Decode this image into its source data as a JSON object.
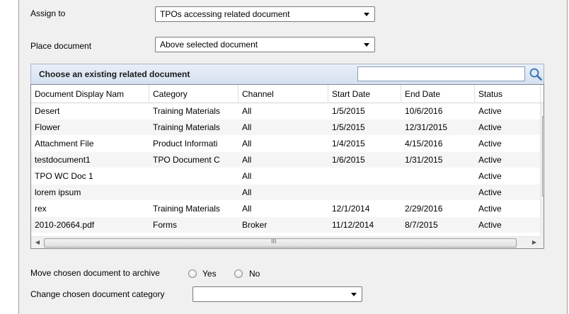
{
  "assign_to": {
    "label": "Assign to",
    "value": "TPOs accessing related document"
  },
  "place_document": {
    "label": "Place document",
    "value": "Above selected document"
  },
  "related_section": {
    "title": "Choose an existing related document",
    "search_value": "",
    "search_icon": "magnifier-icon"
  },
  "grid": {
    "columns": [
      "Document Display Nam",
      "Category",
      "Channel",
      "Start Date",
      "End Date",
      "Status"
    ],
    "rows": [
      [
        "Desert",
        "Training Materials",
        "All",
        "1/5/2015",
        "10/6/2016",
        "Active"
      ],
      [
        "Flower",
        "Training Materials",
        "All",
        "1/5/2015",
        "12/31/2015",
        "Active"
      ],
      [
        "Attachment File",
        "Product Informati",
        "All",
        "1/4/2015",
        "4/15/2016",
        "Active"
      ],
      [
        "testdocument1",
        "TPO Document C",
        "All",
        "1/6/2015",
        "1/31/2015",
        "Active"
      ],
      [
        "TPO WC Doc 1",
        "",
        "All",
        "",
        "",
        "Active"
      ],
      [
        "lorem ipsum",
        "",
        "All",
        "",
        "",
        "Active"
      ],
      [
        "rex",
        "Training Materials",
        "All",
        "12/1/2014",
        "2/29/2016",
        "Active"
      ],
      [
        "2010-20664.pdf",
        "Forms",
        "Broker",
        "11/12/2014",
        "8/7/2015",
        "Active"
      ]
    ],
    "hscroll_grip": "III"
  },
  "archive": {
    "label": "Move chosen document to archive",
    "yes_label": "Yes",
    "no_label": "No"
  },
  "category_change": {
    "label": "Change chosen document category",
    "value": ""
  }
}
